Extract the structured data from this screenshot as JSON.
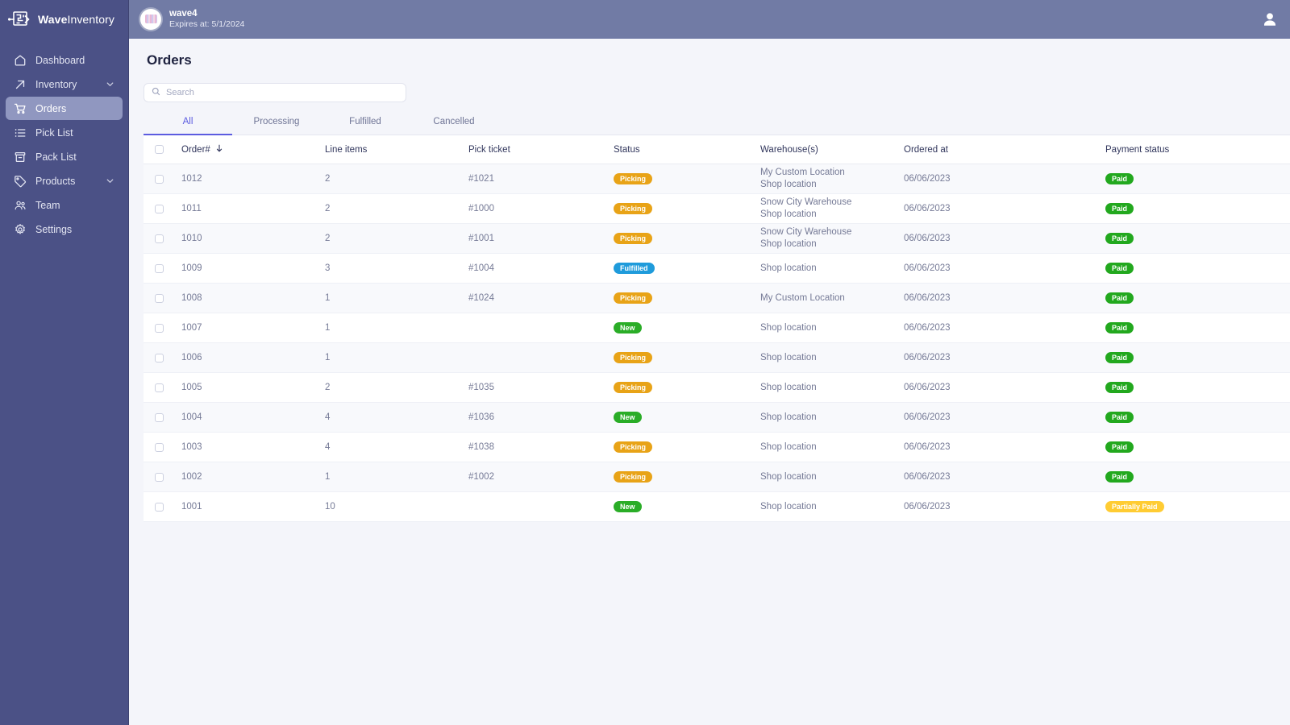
{
  "brand": {
    "name_bold": "Wave",
    "name_light": "Inventory",
    "logo_icon": "maze-arrow-logo-icon"
  },
  "sidebar": {
    "items": [
      {
        "label": "Dashboard",
        "icon": "home-icon",
        "active": false,
        "has_chevron": false
      },
      {
        "label": "Inventory",
        "icon": "arrow-up-right-icon",
        "active": false,
        "has_chevron": true
      },
      {
        "label": "Orders",
        "icon": "shopping-cart-icon",
        "active": true,
        "has_chevron": false
      },
      {
        "label": "Pick List",
        "icon": "list-icon",
        "active": false,
        "has_chevron": false
      },
      {
        "label": "Pack List",
        "icon": "box-icon",
        "active": false,
        "has_chevron": false
      },
      {
        "label": "Products",
        "icon": "tag-icon",
        "active": false,
        "has_chevron": true
      },
      {
        "label": "Team",
        "icon": "users-icon",
        "active": false,
        "has_chevron": false
      },
      {
        "label": "Settings",
        "icon": "gear-icon",
        "active": false,
        "has_chevron": false
      }
    ]
  },
  "topbar": {
    "workspace_name": "wave4",
    "workspace_expires": "Expires at: 5/1/2024",
    "avatar_icon": "workspace-avatar",
    "user_icon": "user-account-icon"
  },
  "page": {
    "title": "Orders"
  },
  "search": {
    "placeholder": "Search",
    "value": "",
    "icon": "search-icon"
  },
  "tabs": [
    {
      "label": "All",
      "active": true
    },
    {
      "label": "Processing",
      "active": false
    },
    {
      "label": "Fulfilled",
      "active": false
    },
    {
      "label": "Cancelled",
      "active": false
    }
  ],
  "table": {
    "sort_column": "Order#",
    "sort_direction_icon": "arrow-down-icon",
    "columns": [
      "Order#",
      "Line items",
      "Pick ticket",
      "Status",
      "Warehouse(s)",
      "Ordered at",
      "Payment status"
    ],
    "rows": [
      {
        "order": "1012",
        "line_items": "2",
        "pick_ticket": "#1021",
        "status": "Picking",
        "status_kind": "picking",
        "warehouses": [
          "My Custom Location",
          "Shop location"
        ],
        "ordered_at": "06/06/2023",
        "payment": "Paid",
        "payment_kind": "paid"
      },
      {
        "order": "1011",
        "line_items": "2",
        "pick_ticket": "#1000",
        "status": "Picking",
        "status_kind": "picking",
        "warehouses": [
          "Snow City Warehouse",
          "Shop location"
        ],
        "ordered_at": "06/06/2023",
        "payment": "Paid",
        "payment_kind": "paid"
      },
      {
        "order": "1010",
        "line_items": "2",
        "pick_ticket": "#1001",
        "status": "Picking",
        "status_kind": "picking",
        "warehouses": [
          "Snow City Warehouse",
          "Shop location"
        ],
        "ordered_at": "06/06/2023",
        "payment": "Paid",
        "payment_kind": "paid"
      },
      {
        "order": "1009",
        "line_items": "3",
        "pick_ticket": "#1004",
        "status": "Fulfilled",
        "status_kind": "fulfilled",
        "warehouses": [
          "Shop location"
        ],
        "ordered_at": "06/06/2023",
        "payment": "Paid",
        "payment_kind": "paid"
      },
      {
        "order": "1008",
        "line_items": "1",
        "pick_ticket": "#1024",
        "status": "Picking",
        "status_kind": "picking",
        "warehouses": [
          "My Custom Location"
        ],
        "ordered_at": "06/06/2023",
        "payment": "Paid",
        "payment_kind": "paid"
      },
      {
        "order": "1007",
        "line_items": "1",
        "pick_ticket": "",
        "status": "New",
        "status_kind": "new",
        "warehouses": [
          "Shop location"
        ],
        "ordered_at": "06/06/2023",
        "payment": "Paid",
        "payment_kind": "paid"
      },
      {
        "order": "1006",
        "line_items": "1",
        "pick_ticket": "",
        "status": "Picking",
        "status_kind": "picking",
        "warehouses": [
          "Shop location"
        ],
        "ordered_at": "06/06/2023",
        "payment": "Paid",
        "payment_kind": "paid"
      },
      {
        "order": "1005",
        "line_items": "2",
        "pick_ticket": "#1035",
        "status": "Picking",
        "status_kind": "picking",
        "warehouses": [
          "Shop location"
        ],
        "ordered_at": "06/06/2023",
        "payment": "Paid",
        "payment_kind": "paid"
      },
      {
        "order": "1004",
        "line_items": "4",
        "pick_ticket": "#1036",
        "status": "New",
        "status_kind": "new",
        "warehouses": [
          "Shop location"
        ],
        "ordered_at": "06/06/2023",
        "payment": "Paid",
        "payment_kind": "paid"
      },
      {
        "order": "1003",
        "line_items": "4",
        "pick_ticket": "#1038",
        "status": "Picking",
        "status_kind": "picking",
        "warehouses": [
          "Shop location"
        ],
        "ordered_at": "06/06/2023",
        "payment": "Paid",
        "payment_kind": "paid"
      },
      {
        "order": "1002",
        "line_items": "1",
        "pick_ticket": "#1002",
        "status": "Picking",
        "status_kind": "picking",
        "warehouses": [
          "Shop location"
        ],
        "ordered_at": "06/06/2023",
        "payment": "Paid",
        "payment_kind": "paid"
      },
      {
        "order": "1001",
        "line_items": "10",
        "pick_ticket": "",
        "status": "New",
        "status_kind": "new",
        "warehouses": [
          "Shop location"
        ],
        "ordered_at": "06/06/2023",
        "payment": "Partially Paid",
        "payment_kind": "partial"
      }
    ]
  },
  "colors": {
    "sidebar_bg": "#4b5186",
    "sidebar_active": "#9097c0",
    "topbar_bg": "#717ba5",
    "accent": "#5c5ce0",
    "page_bg": "#f4f5fa",
    "badge_picking": "#e8a317",
    "badge_fulfilled": "#1f9bdb",
    "badge_new": "#2aad27",
    "badge_paid": "#22a81e",
    "badge_partial": "#ffcc33"
  }
}
